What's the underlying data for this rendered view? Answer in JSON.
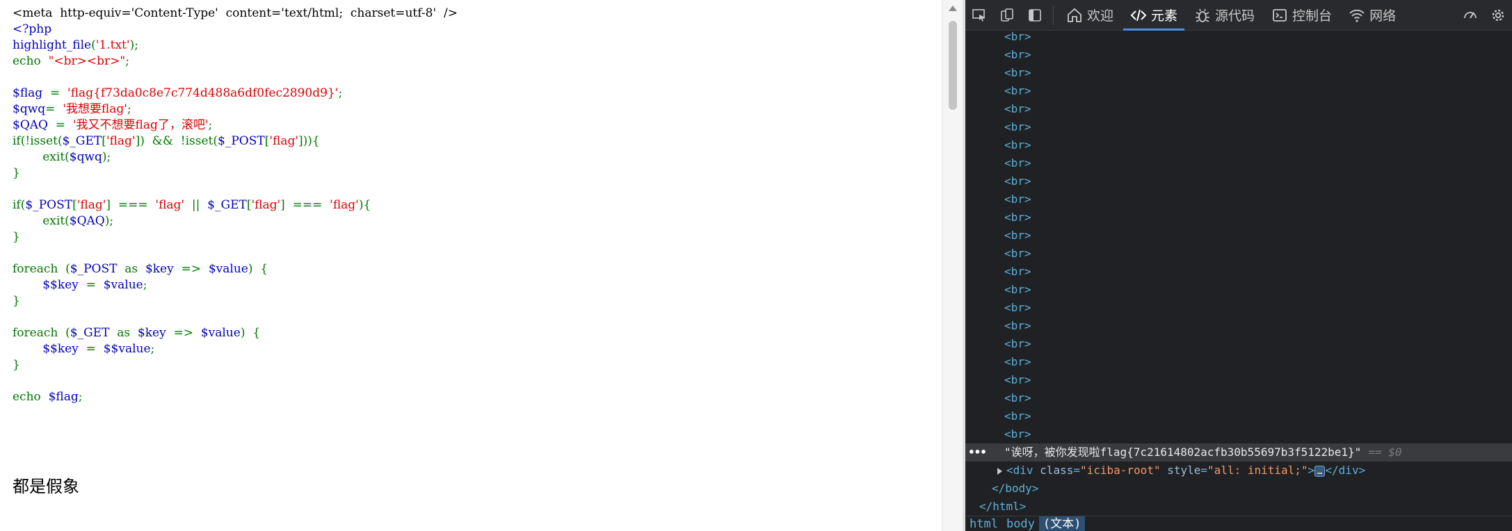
{
  "page": {
    "source_lines": [
      [
        {
          "t": "<meta  http-equiv='Content-Type'  content='text/html;  charset=utf-8'  />",
          "c": "c-html"
        }
      ],
      [
        {
          "t": "<?php",
          "c": "c-var"
        }
      ],
      [
        {
          "t": "highlight_file",
          "c": "c-var"
        },
        {
          "t": "(",
          "c": "c-def"
        },
        {
          "t": "'1.txt'",
          "c": "c-str"
        },
        {
          "t": ");",
          "c": "c-def"
        }
      ],
      [
        {
          "t": "echo  ",
          "c": "c-def"
        },
        {
          "t": "\"<br><br>\"",
          "c": "c-str"
        },
        {
          "t": ";",
          "c": "c-def"
        }
      ],
      [],
      [
        {
          "t": "$flag  ",
          "c": "c-var"
        },
        {
          "t": "=  ",
          "c": "c-def"
        },
        {
          "t": "'flag{f73da0c8e7c774d488a6df0fec2890d9}'",
          "c": "c-str"
        },
        {
          "t": ";",
          "c": "c-def"
        }
      ],
      [
        {
          "t": "$qwq",
          "c": "c-var"
        },
        {
          "t": "=  ",
          "c": "c-def"
        },
        {
          "t": "'我想要flag'",
          "c": "c-str"
        },
        {
          "t": ";",
          "c": "c-def"
        }
      ],
      [
        {
          "t": "$QAQ  ",
          "c": "c-var"
        },
        {
          "t": "=  ",
          "c": "c-def"
        },
        {
          "t": "'我又不想要flag了，滚吧'",
          "c": "c-str"
        },
        {
          "t": ";",
          "c": "c-def"
        }
      ],
      [
        {
          "t": "if(!isset(",
          "c": "c-def"
        },
        {
          "t": "$_GET",
          "c": "c-var"
        },
        {
          "t": "[",
          "c": "c-def"
        },
        {
          "t": "'flag'",
          "c": "c-str"
        },
        {
          "t": "])  &&  !isset(",
          "c": "c-def"
        },
        {
          "t": "$_POST",
          "c": "c-var"
        },
        {
          "t": "[",
          "c": "c-def"
        },
        {
          "t": "'flag'",
          "c": "c-str"
        },
        {
          "t": "])){",
          "c": "c-def"
        }
      ],
      [
        {
          "t": "        exit(",
          "c": "c-def"
        },
        {
          "t": "$qwq",
          "c": "c-var"
        },
        {
          "t": ");",
          "c": "c-def"
        }
      ],
      [
        {
          "t": "}",
          "c": "c-def"
        }
      ],
      [],
      [
        {
          "t": "if(",
          "c": "c-def"
        },
        {
          "t": "$_POST",
          "c": "c-var"
        },
        {
          "t": "[",
          "c": "c-def"
        },
        {
          "t": "'flag'",
          "c": "c-str"
        },
        {
          "t": "]  ===  ",
          "c": "c-def"
        },
        {
          "t": "'flag'",
          "c": "c-str"
        },
        {
          "t": "  ||  ",
          "c": "c-def"
        },
        {
          "t": "$_GET",
          "c": "c-var"
        },
        {
          "t": "[",
          "c": "c-def"
        },
        {
          "t": "'flag'",
          "c": "c-str"
        },
        {
          "t": "]  ===  ",
          "c": "c-def"
        },
        {
          "t": "'flag'",
          "c": "c-str"
        },
        {
          "t": "){",
          "c": "c-def"
        }
      ],
      [
        {
          "t": "        exit(",
          "c": "c-def"
        },
        {
          "t": "$QAQ",
          "c": "c-var"
        },
        {
          "t": ");",
          "c": "c-def"
        }
      ],
      [
        {
          "t": "}",
          "c": "c-def"
        }
      ],
      [],
      [
        {
          "t": "foreach  ",
          "c": "c-def"
        },
        {
          "t": "(",
          "c": "c-def"
        },
        {
          "t": "$_POST  ",
          "c": "c-var"
        },
        {
          "t": "as  ",
          "c": "c-def"
        },
        {
          "t": "$key  ",
          "c": "c-var"
        },
        {
          "t": "=>  ",
          "c": "c-def"
        },
        {
          "t": "$value",
          "c": "c-var"
        },
        {
          "t": ")  {",
          "c": "c-def"
        }
      ],
      [
        {
          "t": "        ",
          "c": "c-def"
        },
        {
          "t": "$$key  ",
          "c": "c-var"
        },
        {
          "t": "=  ",
          "c": "c-def"
        },
        {
          "t": "$value",
          "c": "c-var"
        },
        {
          "t": ";",
          "c": "c-def"
        }
      ],
      [
        {
          "t": "}",
          "c": "c-def"
        }
      ],
      [],
      [
        {
          "t": "foreach  ",
          "c": "c-def"
        },
        {
          "t": "(",
          "c": "c-def"
        },
        {
          "t": "$_GET  ",
          "c": "c-var"
        },
        {
          "t": "as  ",
          "c": "c-def"
        },
        {
          "t": "$key  ",
          "c": "c-var"
        },
        {
          "t": "=>  ",
          "c": "c-def"
        },
        {
          "t": "$value",
          "c": "c-var"
        },
        {
          "t": ")  {",
          "c": "c-def"
        }
      ],
      [
        {
          "t": "        ",
          "c": "c-def"
        },
        {
          "t": "$$key  ",
          "c": "c-var"
        },
        {
          "t": "=  ",
          "c": "c-def"
        },
        {
          "t": "$$value",
          "c": "c-var"
        },
        {
          "t": ";",
          "c": "c-def"
        }
      ],
      [
        {
          "t": "}",
          "c": "c-def"
        }
      ],
      [],
      [
        {
          "t": "echo  ",
          "c": "c-def"
        },
        {
          "t": "$flag",
          "c": "c-var"
        },
        {
          "t": ";",
          "c": "c-def"
        }
      ]
    ],
    "output_text": "都是假象"
  },
  "devtools": {
    "tabs": [
      {
        "label": "欢迎",
        "icon": "home-icon",
        "active": false
      },
      {
        "label": "元素",
        "icon": "code-icon",
        "active": true
      },
      {
        "label": "源代码",
        "icon": "bug-icon",
        "active": false
      },
      {
        "label": "控制台",
        "icon": "console-icon",
        "active": false
      },
      {
        "label": "网络",
        "icon": "wifi-icon",
        "active": false
      }
    ],
    "br_tag": "<br>",
    "br_count": 23,
    "selected_text": "\"诶呀，被你发现啦flag{7c21614802acfb30b55697b3f5122be1}\"",
    "selected_marker": "== $0",
    "div_line": {
      "open": "<div",
      "attr1_name": "class",
      "attr1_val": "\"iciba-root\"",
      "attr2_name": "style",
      "attr2_val": "\"all: initial;\"",
      "gt": ">",
      "ellipsis": "…",
      "close": "</div>"
    },
    "body_close": "</body>",
    "html_close": "</html>",
    "breadcrumb": [
      "html",
      "body",
      "(文本)"
    ],
    "accent": "#4a90e2"
  }
}
